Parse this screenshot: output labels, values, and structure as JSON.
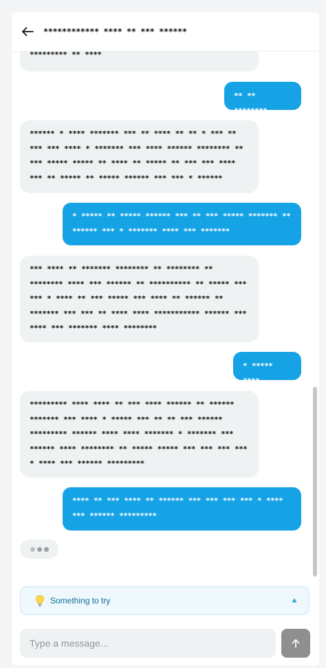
{
  "header": {
    "title": "************ **** ** *** ******",
    "back_icon": "arrow-left-icon"
  },
  "messages": [
    {
      "role": "bot",
      "text": "********* ** ****"
    },
    {
      "role": "user",
      "text": "** ** ********"
    },
    {
      "role": "bot",
      "text": "****** * **** ******* *** ** **** ** ** * *** ** *** *** **** * ******* *** **** ****** ******** ** *** ***** ***** ** **** ** ***** ** *** *** **** *** ** ***** ** ***** ****** *** *** * ******"
    },
    {
      "role": "user",
      "text": "* ***** ** ***** ****** *** ** *** ***** ******* ** ****** *** * ******* **** *** *******"
    },
    {
      "role": "bot",
      "text": "*** **** ** ******* ******** ** ******** ** ******** **** *** ****** ** ********** ** ***** *** *** * **** ** *** ***** *** **** ** ****** ** ******* *** *** ** **** **** *********** ****** *** **** *** ******* **** ********"
    },
    {
      "role": "user",
      "text": "* ***** ****"
    },
    {
      "role": "bot",
      "text": "********* **** **** ** *** **** ****** ** ****** ******* *** **** * ***** *** ** ** *** ****** ********* ****** **** **** ******* * ******* *** ****** **** ******** ** ***** ***** *** *** *** *** * **** *** ****** *********"
    },
    {
      "role": "user",
      "text": "**** ** *** **** ** ****** *** *** *** *** * **** *** ****** *********"
    }
  ],
  "typing_indicator": {
    "icon": "typing-dots-icon"
  },
  "tips": {
    "label": "Something to try",
    "icon": "lightbulb-icon",
    "toggle_icon": "triangle-up-icon"
  },
  "composer": {
    "placeholder": "Type a message...",
    "value": ""
  },
  "send_button": {
    "icon": "arrow-up-icon"
  },
  "colors": {
    "user_bubble": "#16a3e6",
    "bot_bubble": "#eff2f3",
    "tip_background": "#eef8fd",
    "tip_text": "#0c6d96",
    "send_button": "#8f8f8f"
  }
}
